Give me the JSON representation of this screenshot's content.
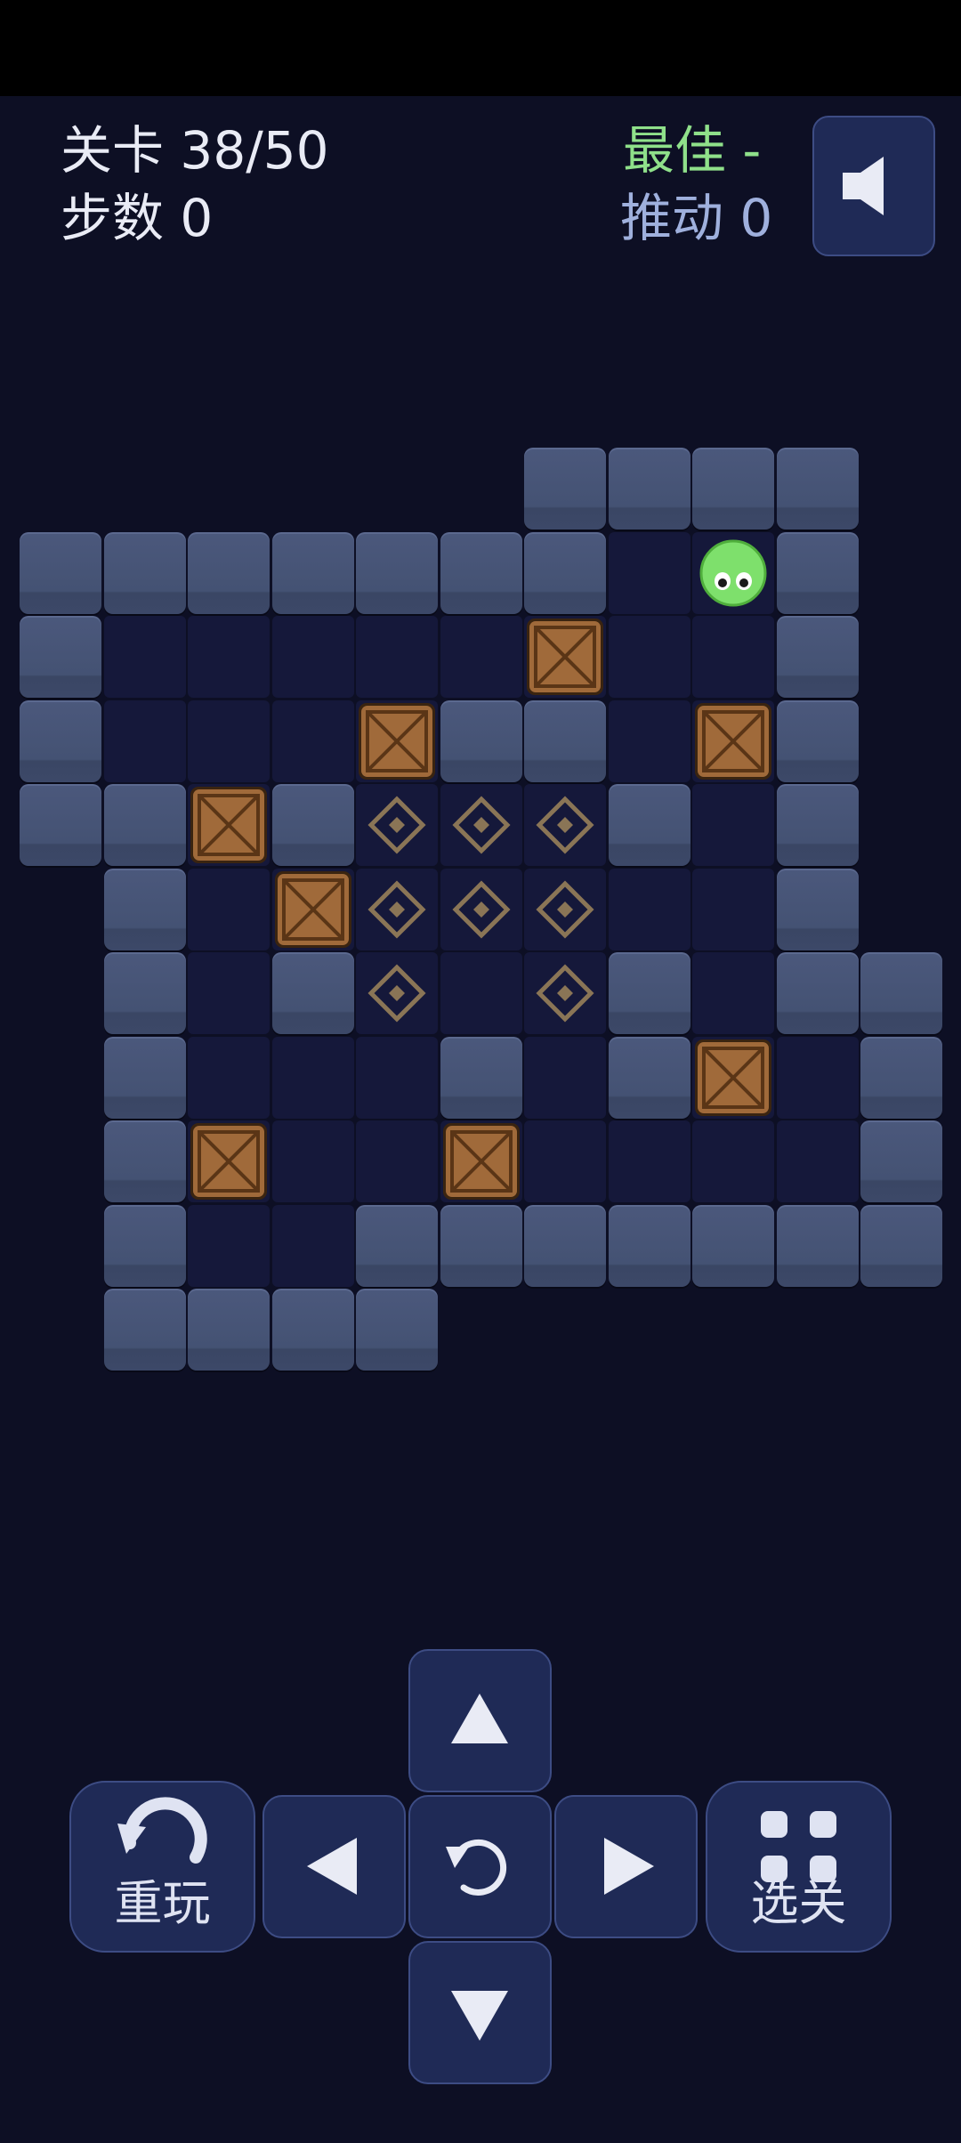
{
  "hud": {
    "level_text": "关卡 38/50",
    "steps_text": "步数 0",
    "best_text": "最佳 -",
    "pushes_text": "推动 0"
  },
  "colors": {
    "background": "#0d0f24",
    "panel": "#1f2a56",
    "best": "#8fe08a",
    "pushes": "#9fb0dd",
    "player": "#7ee06c",
    "crate": "#a06a3a"
  },
  "board": {
    "columns": 11,
    "rows": 11,
    "legend": {
      "#": "wall",
      ".": "floor",
      "T": "target",
      "B": "box",
      "P": "player",
      " ": "empty"
    },
    "grid": [
      "      ####  ",
      "#######.P#  ",
      "#.....B..#  ",
      "#...B##.B#  ",
      "##B#TTT#.#  ",
      " #.BTTT..#  ",
      " #.#T.T#.## ",
      " #...#.#B.# ",
      " #B..B....# ",
      " #..####### ",
      " ####       "
    ]
  },
  "controls": {
    "up_icon": "arrow-up-icon",
    "down_icon": "arrow-down-icon",
    "left_icon": "arrow-left-icon",
    "right_icon": "arrow-right-icon",
    "undo_icon": "undo-icon",
    "restart_icon": "restart-icon",
    "restart_label": "重玩",
    "select_icon": "grid-icon",
    "select_label": "选关",
    "sound_icon": "speaker-icon"
  }
}
